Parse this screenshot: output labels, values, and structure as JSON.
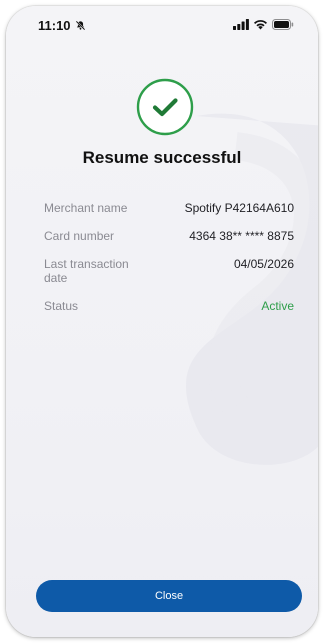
{
  "status_bar": {
    "time": "11:10"
  },
  "result": {
    "title": "Resume successful"
  },
  "details": [
    {
      "label": "Merchant name",
      "value": "Spotify P42164A610"
    },
    {
      "label": "Card number",
      "value": "4364 38** **** 8875"
    },
    {
      "label": "Last transaction date",
      "value": "04/05/2026"
    },
    {
      "label": "Status",
      "value": "Active"
    }
  ],
  "actions": {
    "close_label": "Close"
  },
  "colors": {
    "primary": "#0e5aa8",
    "success": "#2e9e4a",
    "status_active": "#2e9e4a"
  },
  "icons": {
    "status_mute": "bell-slash-icon",
    "signal": "signal-icon",
    "wifi": "wifi-icon",
    "battery": "battery-icon",
    "success": "check-circle-icon"
  }
}
